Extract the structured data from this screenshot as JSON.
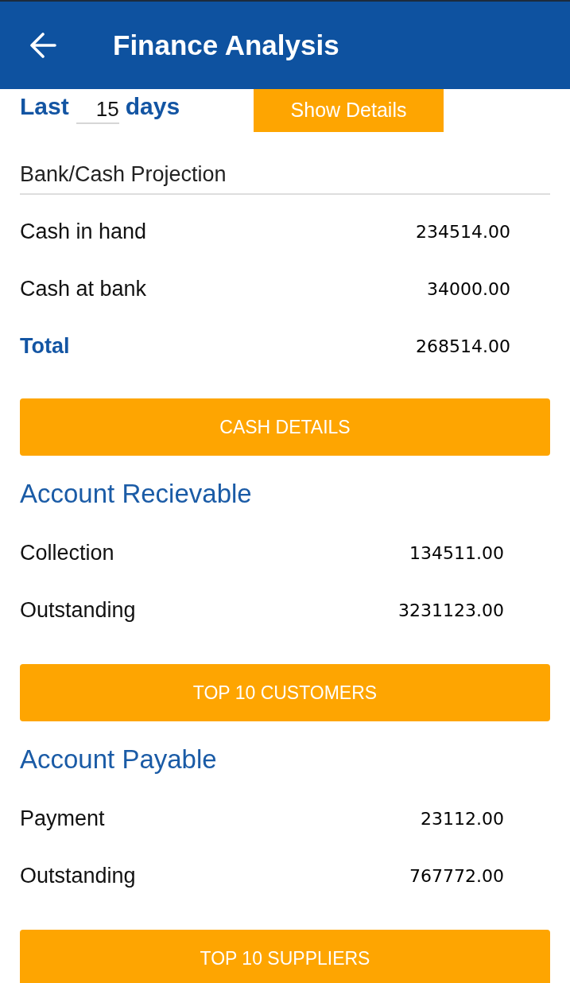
{
  "header": {
    "title": "Finance Analysis"
  },
  "period": {
    "prefix": "Last",
    "days": "15",
    "suffix": "days",
    "button": "Show Details"
  },
  "sections": [
    {
      "kind": "subtitle",
      "title": "Bank/Cash Projection",
      "rows": [
        {
          "kind": "normal",
          "label": "Cash in hand",
          "value": "234514.00"
        },
        {
          "kind": "normal",
          "label": "Cash at bank",
          "value": "34000.00"
        },
        {
          "kind": "total",
          "label": "Total",
          "value": "268514.00"
        }
      ],
      "button": "CASH DETAILS"
    },
    {
      "kind": "heading",
      "title": "Account Recievable",
      "rows": [
        {
          "kind": "normal",
          "label": "Collection",
          "value": "134511.00"
        },
        {
          "kind": "normal",
          "label": "Outstanding",
          "value": "3231123.00"
        }
      ],
      "button": "TOP 10 CUSTOMERS"
    },
    {
      "kind": "heading",
      "title": "Account Payable",
      "rows": [
        {
          "kind": "normal",
          "label": "Payment",
          "value": "23112.00"
        },
        {
          "kind": "normal",
          "label": "Outstanding",
          "value": "767772.00"
        }
      ],
      "button": "TOP 10 SUPPLIERS"
    }
  ]
}
